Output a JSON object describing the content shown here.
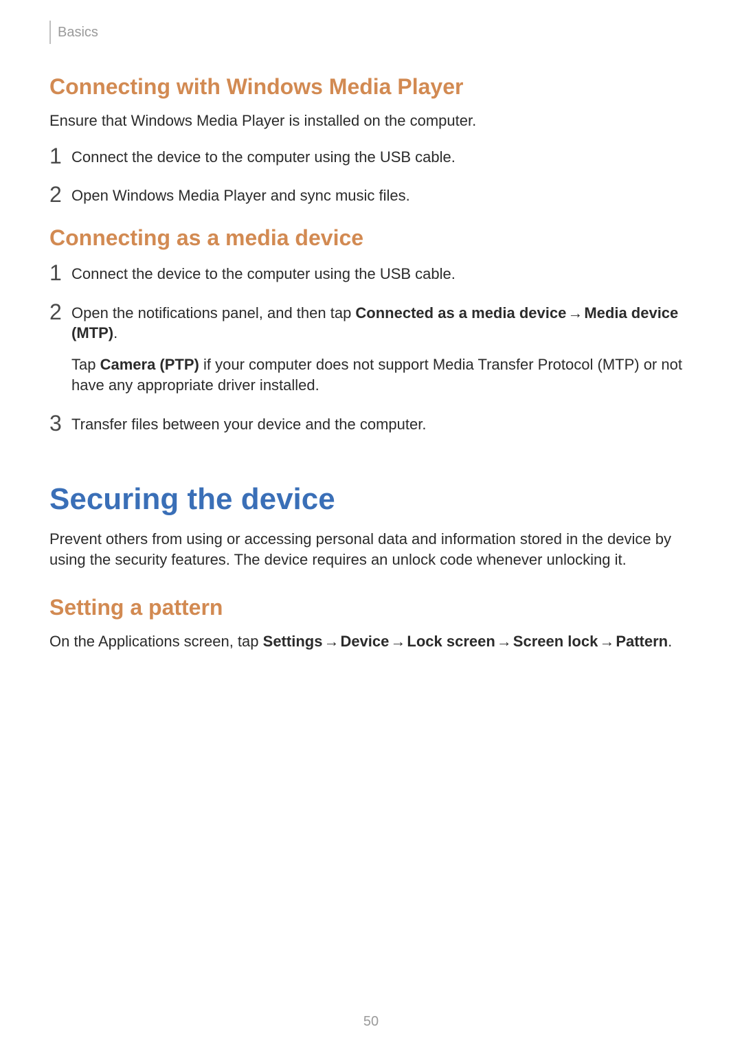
{
  "header": {
    "breadcrumb": "Basics"
  },
  "page_number": "50",
  "arrow": "→",
  "sections": {
    "wmp": {
      "title": "Connecting with Windows Media Player",
      "intro": "Ensure that Windows Media Player is installed on the computer.",
      "step1_num": "1",
      "step1": "Connect the device to the computer using the USB cable.",
      "step2_num": "2",
      "step2": "Open Windows Media Player and sync music files."
    },
    "media": {
      "title": "Connecting as a media device",
      "step1_num": "1",
      "step1": "Connect the device to the computer using the USB cable.",
      "step2_num": "2",
      "step2_pre": "Open the notifications panel, and then tap ",
      "step2_bold1": "Connected as a media device",
      "step2_bold2": "Media device (MTP)",
      "step2_post": ".",
      "step2_sub_pre": "Tap ",
      "step2_sub_bold": "Camera (PTP)",
      "step2_sub_post": " if your computer does not support Media Transfer Protocol (MTP) or not have any appropriate driver installed.",
      "step3_num": "3",
      "step3": "Transfer files between your device and the computer."
    },
    "securing": {
      "title": "Securing the device",
      "intro": "Prevent others from using or accessing personal data and information stored in the device by using the security features. The device requires an unlock code whenever unlocking it."
    },
    "pattern": {
      "title": "Setting a pattern",
      "p_pre": "On the Applications screen, tap ",
      "p_b1": "Settings",
      "p_b2": "Device",
      "p_b3": "Lock screen",
      "p_b4": "Screen lock",
      "p_b5": "Pattern",
      "p_post": "."
    }
  }
}
